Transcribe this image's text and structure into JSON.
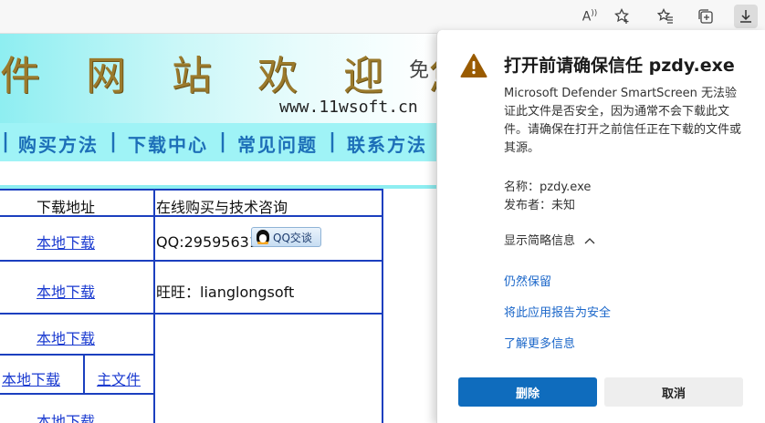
{
  "browser": {
    "toolbar_icons": [
      "read-aloud-icon",
      "add-favorite-icon",
      "favorites-icon",
      "collections-icon",
      "downloads-icon"
    ],
    "read_aloud_glyph": "A͓"
  },
  "webpage": {
    "banner_title": "件 网 站 欢 迎 您",
    "banner_sub": "免",
    "banner_url": "www.11wsoft.cn",
    "nav": [
      "购买方法",
      "下载中心",
      "常见问题",
      "联系方法"
    ],
    "table": {
      "header_download": "下载地址",
      "header_buy": "在线购买与技术咨询",
      "local_download": "本地下载",
      "main_file": "主文件",
      "qq_text": "QQ:29595631",
      "qq_button": "QQ交谈",
      "wangwang": "旺旺：lianglongsoft"
    }
  },
  "popup": {
    "title": "打开前请确保信任 pzdy.exe",
    "description": "Microsoft Defender SmartScreen 无法验证此文件是否安全，因为通常不会下载此文件。请确保在打开之前信任正在下载的文件或其源。",
    "name_line": "名称：pzdy.exe",
    "publisher_line": "发布者：未知",
    "details_toggle": "显示简略信息",
    "links": [
      "仍然保留",
      "将此应用报告为安全",
      "了解更多信息"
    ],
    "delete_button": "删除",
    "cancel_button": "取消",
    "warning_color": "#9a5b00"
  }
}
